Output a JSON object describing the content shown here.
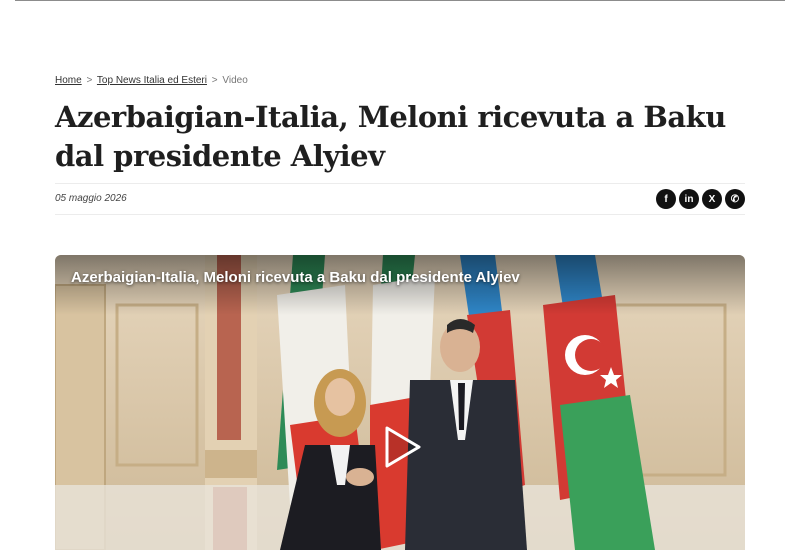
{
  "breadcrumb": {
    "home": "Home",
    "separator": ">",
    "section": "Top News Italia ed Esteri",
    "current": "Video"
  },
  "article": {
    "title": "Azerbaigian-Italia, Meloni ricevuta a Baku dal presidente Alyiev",
    "date": "05 maggio 2026"
  },
  "share": {
    "facebook": {
      "icon": "facebook-icon",
      "glyph": "f"
    },
    "linkedin": {
      "icon": "linkedin-icon",
      "glyph": "in"
    },
    "x": {
      "icon": "x-icon",
      "glyph": "X"
    },
    "whatsapp": {
      "icon": "whatsapp-icon",
      "glyph": "✆"
    }
  },
  "video": {
    "title": "Azerbaigian-Italia, Meloni ricevuta a Baku dal presidente Alyiev",
    "play_icon": "play-icon"
  },
  "colors": {
    "text": "#1f1f1f",
    "share_bg": "#111111",
    "italy_green": "#2e8b57",
    "italy_red": "#d93a2f",
    "az_blue": "#2f86c8",
    "az_red": "#d23a34",
    "az_green": "#3aa05a"
  }
}
